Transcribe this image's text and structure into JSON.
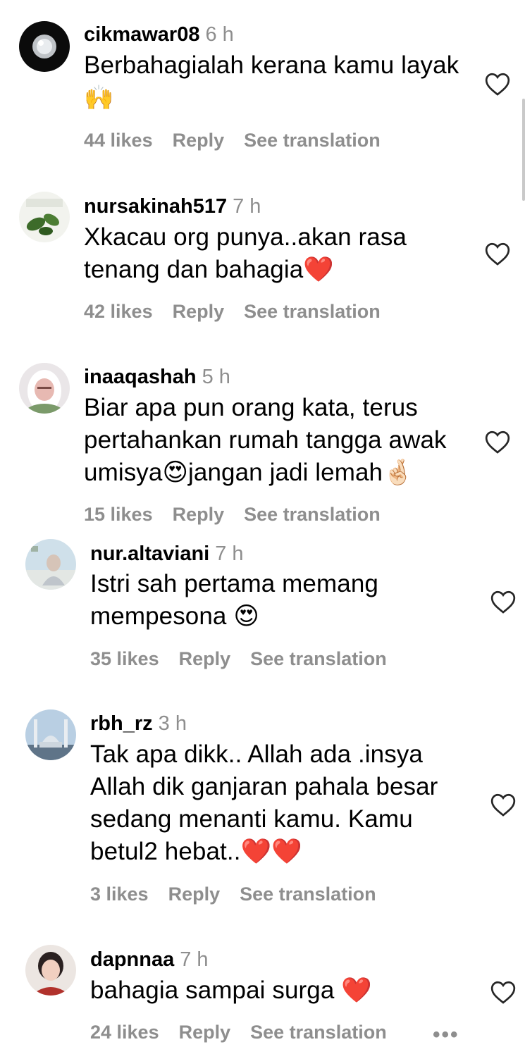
{
  "comments": [
    {
      "username": "cikmawar08",
      "time": "6 h",
      "lines": [
        "Berbahagialah kerana kamu layak",
        "🙌"
      ],
      "likes": "44 likes",
      "reply": "Reply",
      "translate": "See translation"
    },
    {
      "username": "nursakinah517",
      "time": "7 h",
      "lines": [
        "Xkacau org punya..akan rasa",
        "tenang dan bahagia❤️"
      ],
      "likes": "42 likes",
      "reply": "Reply",
      "translate": "See translation"
    },
    {
      "username": "inaaqashah",
      "time": "5 h",
      "lines": [
        "Biar apa pun orang kata, terus",
        "pertahankan rumah tangga awak",
        "umisya😍jangan jadi lemah🤞🏻"
      ],
      "likes": "15 likes",
      "reply": "Reply",
      "translate": "See translation"
    },
    {
      "username": "nur.altaviani",
      "time": "7 h",
      "lines": [
        "Istri sah pertama memang",
        "mempesona 😍"
      ],
      "likes": "35 likes",
      "reply": "Reply",
      "translate": "See translation"
    },
    {
      "username": "rbh_rz",
      "time": "3 h",
      "lines": [
        "Tak apa dikk.. Allah ada .insya",
        "Allah dik ganjaran pahala besar",
        "sedang menanti kamu. Kamu",
        "betul2 hebat..❤️❤️"
      ],
      "likes": "3 likes",
      "reply": "Reply",
      "translate": "See translation"
    },
    {
      "username": "dapnnaa",
      "time": "7 h",
      "lines": [
        "bahagia sampai surga ❤️"
      ],
      "likes": "24 likes",
      "reply": "Reply",
      "translate": "See translation"
    }
  ],
  "more_label": "•••",
  "icons": {
    "like": "heart-outline-icon",
    "more": "more-options-icon"
  },
  "colors": {
    "secondary_text": "#8e8e8e",
    "heart_stroke": "#262626"
  }
}
